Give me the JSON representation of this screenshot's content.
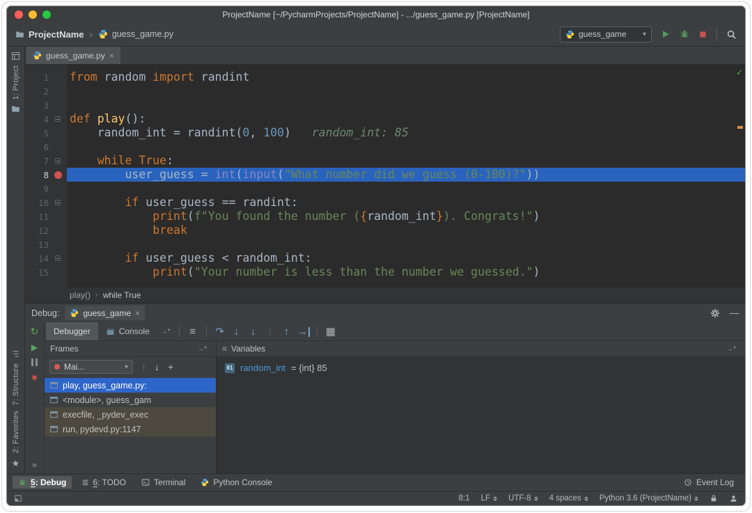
{
  "window": {
    "title": "ProjectName [~/PycharmProjects/ProjectName] - .../guess_game.py [ProjectName]"
  },
  "navbar": {
    "project": "ProjectName",
    "file": "guess_game.py",
    "run_config": "guess_game"
  },
  "left_stripe": {
    "project": "1: Project",
    "structure": "7: Structure",
    "favorites": "2: Favorites"
  },
  "icons": {
    "chevron": "›",
    "close": "×",
    "dropdown": "▾",
    "check": "✓",
    "rerun": "↻",
    "resume": "▶",
    "stop": "■",
    "more": "»",
    "show_execution_point": "≡",
    "step_over": "↷",
    "step_into": "↓",
    "force_step_into": "↓",
    "smart_step_into": "↓",
    "step_out": "↑",
    "run_to_cursor": "→",
    "evaluate": "▦",
    "frame_up": "↑",
    "frame_down": "↓",
    "add": "+",
    "minimize": "—",
    "pin": "→*",
    "todo": "≣",
    "star": "★",
    "variables_list": "≡"
  },
  "editor": {
    "tab_title": "guess_game.py",
    "breadcrumbs": [
      "play()",
      "while True"
    ],
    "breakpoint_line": 8,
    "active_line": 8,
    "fold_lines": [
      4,
      7,
      10,
      14
    ],
    "lines": [
      {
        "n": 1,
        "tokens": [
          {
            "c": "kw",
            "t": "from"
          },
          {
            "c": "pl",
            "t": " random "
          },
          {
            "c": "kw",
            "t": "import"
          },
          {
            "c": "pl",
            "t": " randint"
          }
        ]
      },
      {
        "n": 2,
        "tokens": []
      },
      {
        "n": 3,
        "tokens": []
      },
      {
        "n": 4,
        "tokens": [
          {
            "c": "kw",
            "t": "def"
          },
          {
            "c": "pl",
            "t": " "
          },
          {
            "c": "fn",
            "t": "play"
          },
          {
            "c": "pl",
            "t": "():"
          }
        ]
      },
      {
        "n": 5,
        "tokens": [
          {
            "c": "pl",
            "t": "    random_int = randint("
          },
          {
            "c": "num",
            "t": "0"
          },
          {
            "c": "pl",
            "t": ", "
          },
          {
            "c": "num",
            "t": "100"
          },
          {
            "c": "pl",
            "t": ")"
          },
          {
            "c": "hint",
            "t": "   random_int: 85"
          }
        ]
      },
      {
        "n": 6,
        "tokens": []
      },
      {
        "n": 7,
        "tokens": [
          {
            "c": "pl",
            "t": "    "
          },
          {
            "c": "kw",
            "t": "while"
          },
          {
            "c": "pl",
            "t": " "
          },
          {
            "c": "kw",
            "t": "True"
          },
          {
            "c": "pl",
            "t": ":"
          }
        ]
      },
      {
        "n": 8,
        "tokens": [
          {
            "c": "pl",
            "t": "        user_guess = "
          },
          {
            "c": "bi",
            "t": "int"
          },
          {
            "c": "pl",
            "t": "("
          },
          {
            "c": "bi",
            "t": "input"
          },
          {
            "c": "pl",
            "t": "("
          },
          {
            "c": "str",
            "t": "\"What number did we guess (0-100)?\""
          },
          {
            "c": "pl",
            "t": "))"
          }
        ]
      },
      {
        "n": 9,
        "tokens": []
      },
      {
        "n": 10,
        "tokens": [
          {
            "c": "pl",
            "t": "        "
          },
          {
            "c": "kw",
            "t": "if"
          },
          {
            "c": "pl",
            "t": " user_guess == randint:"
          }
        ]
      },
      {
        "n": 11,
        "tokens": [
          {
            "c": "pl",
            "t": "            "
          },
          {
            "c": "kw",
            "t": "print"
          },
          {
            "c": "pl",
            "t": "("
          },
          {
            "c": "str",
            "t": "f\"You found the number ("
          },
          {
            "c": "kw",
            "t": "{"
          },
          {
            "c": "pl",
            "t": "random_int"
          },
          {
            "c": "kw",
            "t": "}"
          },
          {
            "c": "str",
            "t": "). Congrats!\""
          },
          {
            "c": "pl",
            "t": ")"
          }
        ]
      },
      {
        "n": 12,
        "tokens": [
          {
            "c": "pl",
            "t": "            "
          },
          {
            "c": "kw",
            "t": "break"
          }
        ]
      },
      {
        "n": 13,
        "tokens": []
      },
      {
        "n": 14,
        "tokens": [
          {
            "c": "pl",
            "t": "        "
          },
          {
            "c": "kw",
            "t": "if"
          },
          {
            "c": "pl",
            "t": " user_guess < random_int:"
          }
        ]
      },
      {
        "n": 15,
        "tokens": [
          {
            "c": "pl",
            "t": "            "
          },
          {
            "c": "kw",
            "t": "print"
          },
          {
            "c": "pl",
            "t": "("
          },
          {
            "c": "str",
            "t": "\"Your number is less than the number we guessed.\""
          },
          {
            "c": "pl",
            "t": ")"
          }
        ]
      }
    ]
  },
  "debug_panel": {
    "label": "Debug:",
    "session_tab": "guess_game",
    "debugger_tab": "Debugger",
    "console_tab": "Console",
    "frames_header": "Frames",
    "variables_header": "Variables",
    "thread_selector": "Mai...",
    "frames": [
      {
        "label": "play, guess_game.py:",
        "state": "selected"
      },
      {
        "label": "<module>, guess_gam",
        "state": "normal"
      },
      {
        "label": "execfile, _pydev_exec",
        "state": "library"
      },
      {
        "label": "run, pydevd.py:1147",
        "state": "library"
      }
    ],
    "variable": {
      "icon_text": "01",
      "name": "random_int",
      "value": "= {int} 85"
    }
  },
  "bottom_bar": {
    "debug": {
      "mnemonic": "5",
      "rest": ": Debug"
    },
    "todo": {
      "mnemonic": "6",
      "rest": ": TODO"
    },
    "terminal": "Terminal",
    "python_console": "Python Console",
    "event_log": "Event Log"
  },
  "status_bar": {
    "position": "8:1",
    "line_ending": "LF",
    "encoding": "UTF-8",
    "indent": "4 spaces",
    "interpreter": "Python 3.6 (ProjectName)"
  },
  "colors": {
    "execution_line": "#2a63bd",
    "breakpoint": "#d25252",
    "selected_frame": "#2e65c9",
    "library_frame_bg": "#4d493e",
    "keyword": "#cc7832",
    "string": "#6a8759",
    "number": "#6897bb",
    "builtin": "#8888c6"
  }
}
